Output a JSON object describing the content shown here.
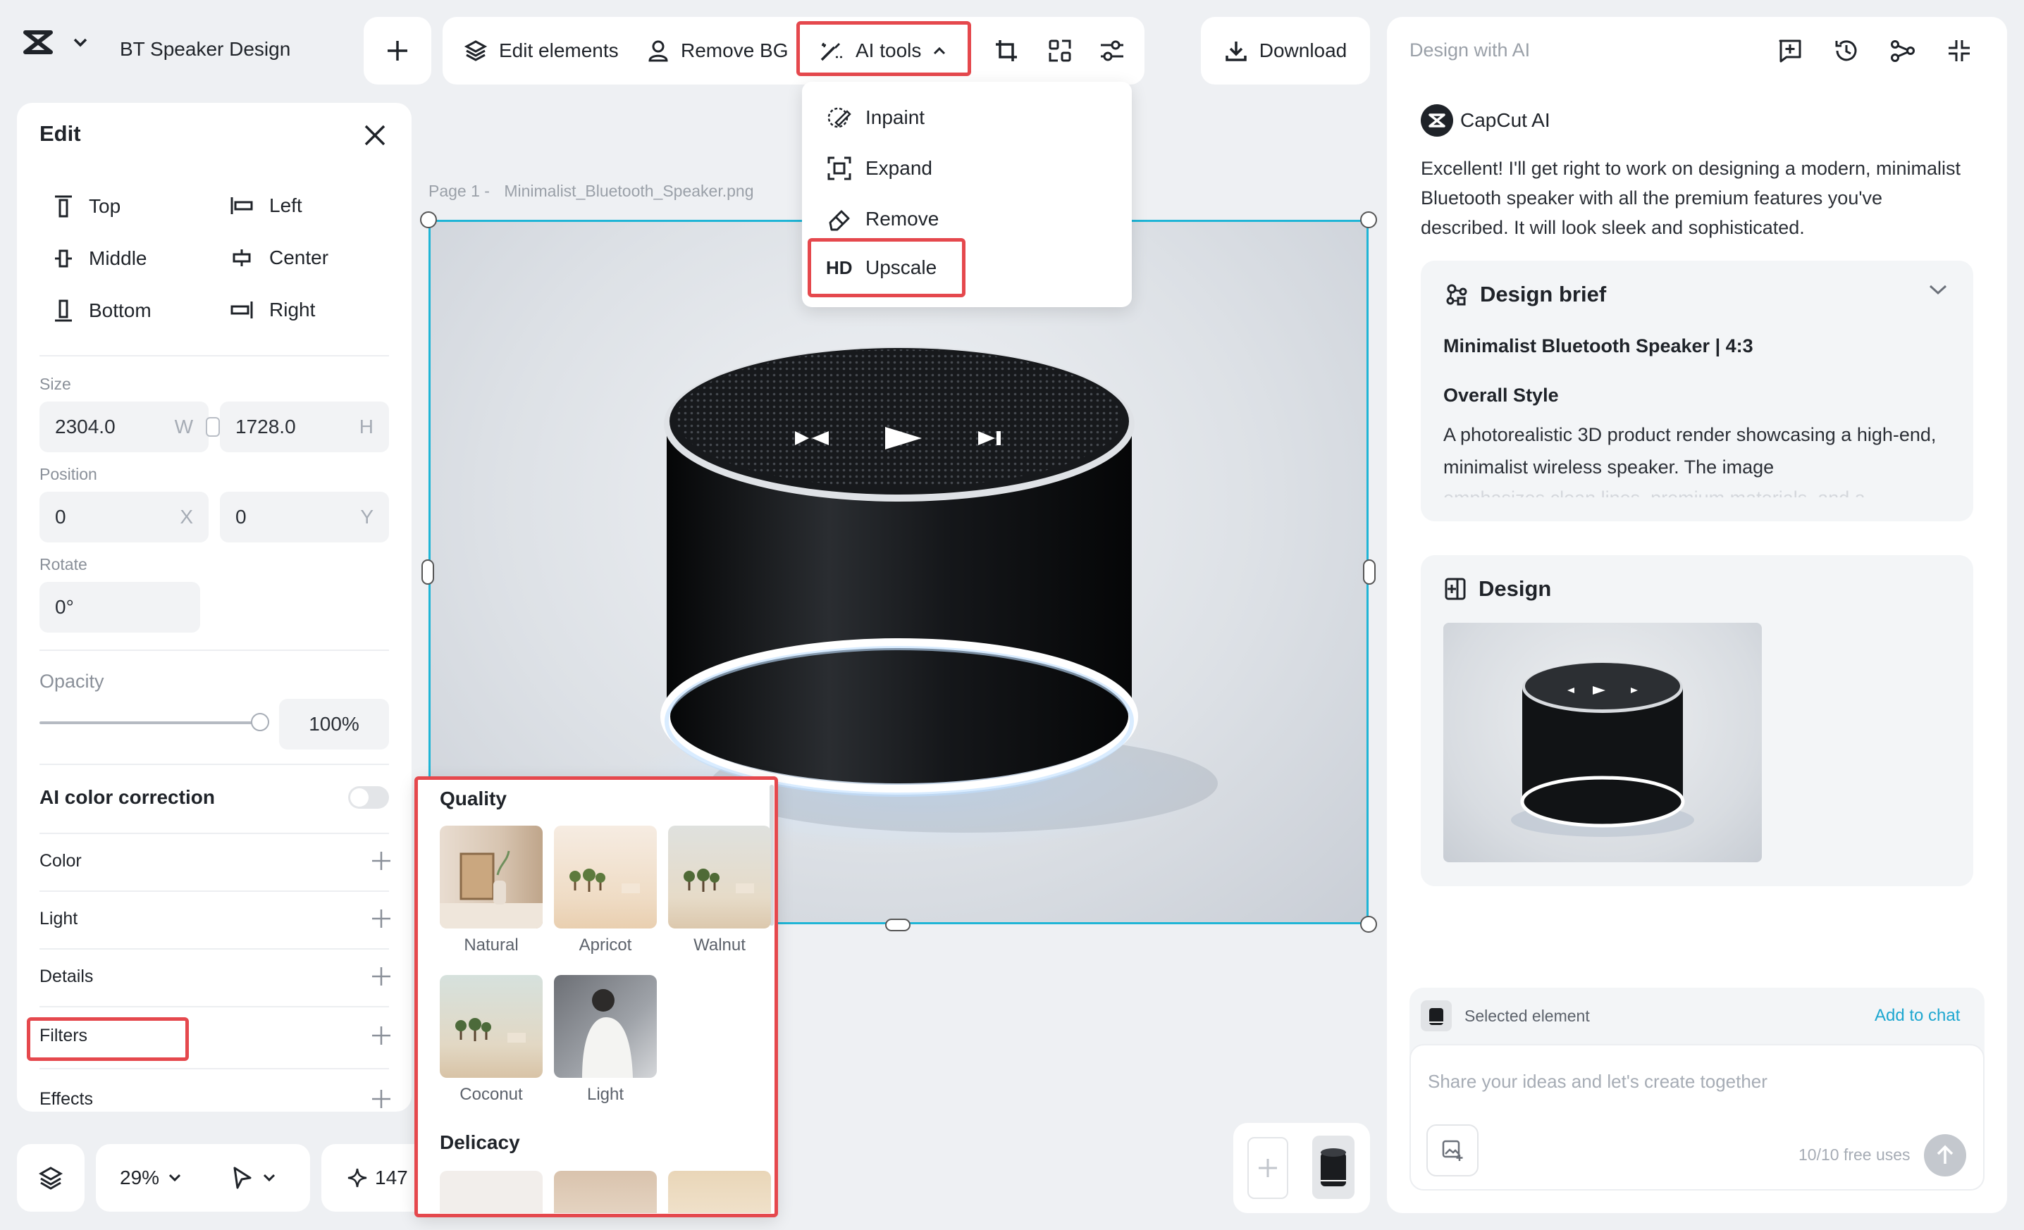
{
  "header": {
    "project_name": "BT Speaker Design"
  },
  "toolbar": {
    "edit_elements": "Edit elements",
    "remove_bg": "Remove BG",
    "ai_tools": "AI tools",
    "download": "Download"
  },
  "ai_tools_menu": {
    "items": [
      {
        "label": "Inpaint",
        "icon": "inpaint-icon"
      },
      {
        "label": "Expand",
        "icon": "expand-icon"
      },
      {
        "label": "Remove",
        "icon": "eraser-icon"
      },
      {
        "label": "Upscale",
        "badge": "HD"
      }
    ]
  },
  "edit_panel": {
    "title": "Edit",
    "align": [
      {
        "label": "Top"
      },
      {
        "label": "Left"
      },
      {
        "label": "Middle"
      },
      {
        "label": "Center"
      },
      {
        "label": "Bottom"
      },
      {
        "label": "Right"
      }
    ],
    "size_label": "Size",
    "width": "2304.0",
    "width_suffix": "W",
    "height": "1728.0",
    "height_suffix": "H",
    "position_label": "Position",
    "pos_x": "0",
    "pos_x_suffix": "X",
    "pos_y": "0",
    "pos_y_suffix": "Y",
    "rotate_label": "Rotate",
    "rotate": "0°",
    "opacity_label": "Opacity",
    "opacity": "100%",
    "opacity_level": 1.0,
    "ai_color_correction": "AI color correction",
    "ai_color_correction_on": false,
    "sections": [
      "Color",
      "Light",
      "Details",
      "Filters",
      "Effects"
    ]
  },
  "canvas": {
    "page_label": "Page 1 -",
    "file_name": "Minimalist_Bluetooth_Speaker.png"
  },
  "filters_popover": {
    "group1": "Quality",
    "filters": [
      "Natural",
      "Apricot",
      "Walnut",
      "Coconut",
      "Light"
    ],
    "group2": "Delicacy"
  },
  "bottom_bar": {
    "zoom": "29%",
    "credits": "147"
  },
  "ai_panel": {
    "title": "Design with AI",
    "assistant_name": "CapCut AI",
    "message": "Excellent! I'll get right to work on designing a modern, minimalist Bluetooth speaker with all the premium features you've described. It will look sleek and sophisticated.",
    "brief": {
      "title": "Design brief",
      "subtitle": "Minimalist Bluetooth Speaker | 4:3",
      "style_heading": "Overall Style",
      "style_text": "A photorealistic 3D product render showcasing a high-end, minimalist wireless speaker. The image",
      "fade_text": "emphasizes clean lines, premium materials, and a"
    },
    "design": {
      "title": "Design"
    },
    "selected_element": "Selected element",
    "add_to_chat": "Add to chat",
    "input_placeholder": "Share your ideas and let's create together",
    "free_uses": "10/10 free uses"
  },
  "colors": {
    "accent": "#1fb5d6",
    "highlight": "#e5484d",
    "link": "#1ea7d0"
  }
}
